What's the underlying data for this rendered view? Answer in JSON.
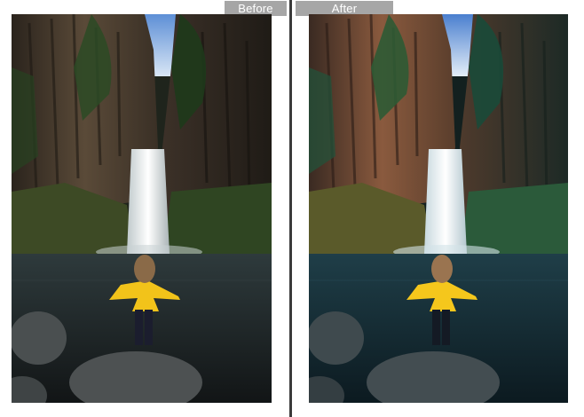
{
  "labels": {
    "before": "Before",
    "after": "After"
  },
  "colors": {
    "label_bg": "#a6a6a6",
    "label_text": "#ffffff",
    "divider": "#3a3a3a",
    "jacket": "#f2c31a"
  },
  "photos": {
    "before": {
      "subject": "waterfall-photo-original"
    },
    "after": {
      "subject": "waterfall-photo-edited"
    }
  }
}
